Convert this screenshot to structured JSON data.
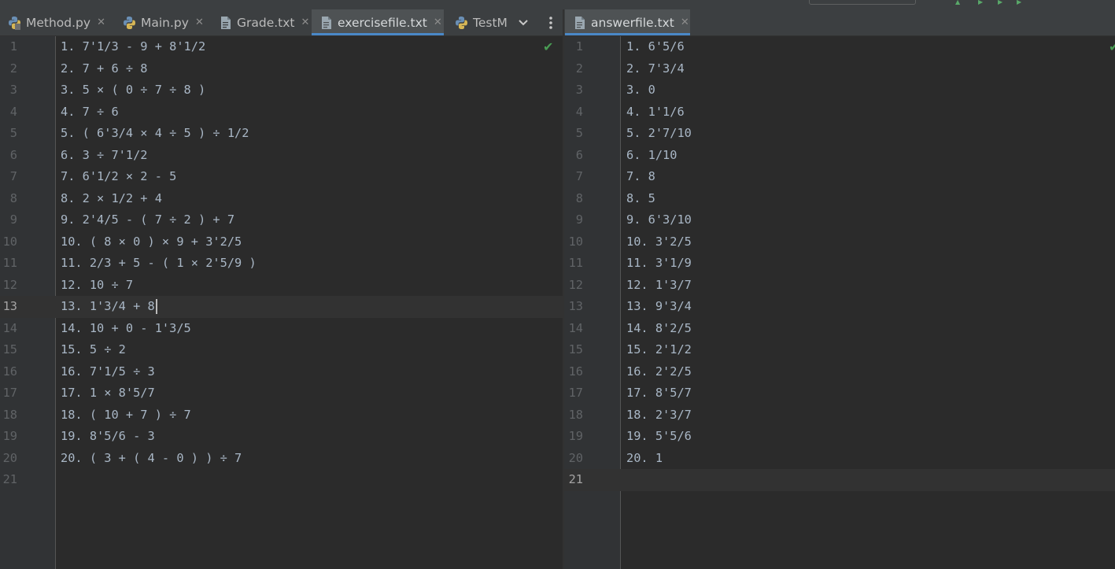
{
  "window": {
    "title": "",
    "colors": {
      "background": "#2b2b2b",
      "gutter": "#313335",
      "tab_bar": "#3c3f41",
      "active_tab": "#4e5254",
      "accent": "#4a88c7",
      "text": "#a9b7c6",
      "ok": "#499c54"
    }
  },
  "left_editor": {
    "tabs": [
      {
        "label": "Method.py",
        "icon": "python-file-icon",
        "active": false
      },
      {
        "label": "Main.py",
        "icon": "python-file-icon",
        "active": false
      },
      {
        "label": "Grade.txt",
        "icon": "text-file-icon",
        "active": false
      },
      {
        "label": "exercisefile.txt",
        "icon": "text-file-icon",
        "active": true
      },
      {
        "label": "TestM",
        "icon": "python-file-icon",
        "active": false
      }
    ],
    "overflow_icon": "chevron-down-icon",
    "menu_icon": "more-vert-icon",
    "status_icon": "check-icon",
    "current_line": 13,
    "line_numbers": [
      "1",
      "2",
      "3",
      "4",
      "5",
      "6",
      "7",
      "8",
      "9",
      "10",
      "11",
      "12",
      "13",
      "14",
      "15",
      "16",
      "17",
      "18",
      "19",
      "20",
      "21"
    ],
    "lines": [
      "1. 7'1/3 - 9 + 8'1/2",
      "2. 7 + 6 ÷ 8",
      "3. 5 × ( 0 ÷ 7 ÷ 8 )",
      "4. 7 ÷ 6",
      "5. ( 6'3/4 × 4 ÷ 5 ) ÷ 1/2",
      "6. 3 ÷ 7'1/2",
      "7. 6'1/2 × 2 - 5",
      "8. 2 × 1/2 + 4",
      "9. 2'4/5 - ( 7 ÷ 2 ) + 7",
      "10. ( 8 × 0 ) × 9 + 3'2/5",
      "11. 2/3 + 5 - ( 1 × 2'5/9 )",
      "12. 10 ÷ 7",
      "13. 1'3/4 + 8",
      "14. 10 + 0 - 1'3/5",
      "15. 5 ÷ 2",
      "16. 7'1/5 ÷ 3",
      "17. 1 × 8'5/7",
      "18. ( 10 + 7 ) ÷ 7",
      "19. 8'5/6 - 3",
      "20. ( 3 + ( 4 - 0 ) ) ÷ 7",
      ""
    ]
  },
  "right_editor": {
    "tabs": [
      {
        "label": "answerfile.txt",
        "icon": "text-file-icon",
        "active": true
      }
    ],
    "status_icon": "check-icon",
    "current_line": 21,
    "line_numbers": [
      "1",
      "2",
      "3",
      "4",
      "5",
      "6",
      "7",
      "8",
      "9",
      "10",
      "11",
      "12",
      "13",
      "14",
      "15",
      "16",
      "17",
      "18",
      "19",
      "20",
      "21"
    ],
    "lines": [
      "1. 6'5/6",
      "2. 7'3/4",
      "3. 0",
      "4. 1'1/6",
      "5. 2'7/10",
      "6. 1/10",
      "7. 8",
      "8. 5",
      "9. 6'3/10",
      "10. 3'2/5",
      "11. 3'1/9",
      "12. 1'3/7",
      "13. 9'3/4",
      "14. 8'2/5",
      "15. 2'1/2",
      "16. 2'2/5",
      "17. 8'5/7",
      "18. 2'3/7",
      "19. 5'5/6",
      "20. 1",
      ""
    ]
  }
}
